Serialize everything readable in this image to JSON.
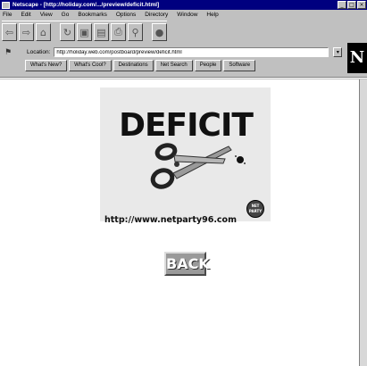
{
  "window": {
    "title": "Netscape - [http://holiday.com/.../preview/deficit.html]",
    "minimize": "_",
    "maximize": "□",
    "close": "×"
  },
  "menu": [
    "File",
    "Edit",
    "View",
    "Go",
    "Bookmarks",
    "Options",
    "Directory",
    "Window",
    "Help"
  ],
  "toolbar": {
    "icons": [
      "back-icon",
      "forward-icon",
      "home-icon",
      "reload-icon",
      "images-icon",
      "open-icon",
      "print-icon",
      "find-icon",
      "stop-icon"
    ]
  },
  "location": {
    "label": "Location:",
    "url": "http://holiday.web.com/postboard/preview/deficit.html"
  },
  "directory_buttons": [
    "What's New?",
    "What's Cool?",
    "Destinations",
    "Net Search",
    "People",
    "Software"
  ],
  "logo": "N",
  "page": {
    "banner_title": "DEFICIT",
    "banner_url": "http://www.netparty96.com",
    "badge_text": "NET PARTY",
    "back_label": "BACK"
  },
  "colors": {
    "titlebar": "#00007f",
    "chrome": "#c0c0c0",
    "back_button": "#9a9a9a"
  }
}
